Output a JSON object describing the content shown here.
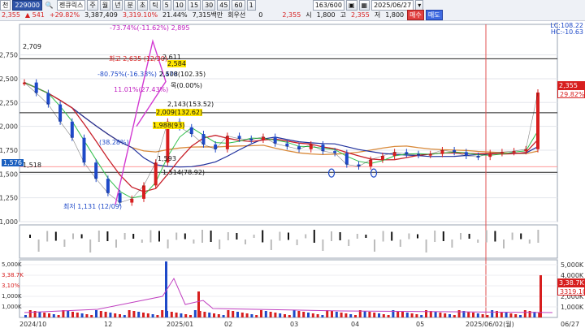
{
  "toolbar": {
    "row1": {
      "market": "천",
      "code": "229000",
      "name": "젠큐릭스",
      "periods": [
        "주",
        "월",
        "년",
        "분",
        "초",
        "틱"
      ],
      "intervals": [
        "5",
        "10",
        "15",
        "30",
        "45",
        "60",
        "1"
      ],
      "count": "163/600",
      "date": "2025/06/27"
    },
    "row2": {
      "price": "2,355",
      "change": "▲ 541",
      "change_pct": "+29.82%",
      "volume": "3,387,409",
      "amount": "3,319.10%",
      "turnover": "21.44%",
      "value": "7,315백만",
      "priority_label": "회우선",
      "priority_value": "0",
      "cur_price": "2,355",
      "open_label": "시",
      "open": "1,800",
      "high_label": "고",
      "high": "2,355",
      "low_label": "저",
      "low": "1,800",
      "buy_label": "매수",
      "sell_label": "매도"
    }
  },
  "indicator_legend": {
    "lc": "LC:108.22",
    "hc": "HC:-10.63"
  },
  "right_tags": {
    "price": "2,355",
    "pct": "29.82%",
    "low_line": "1,576",
    "vol_tag": "3,38.7K",
    "vol_pct": "3319.10%"
  },
  "chart_data": {
    "type": "line",
    "title": "",
    "xlabel": "",
    "ylabel": "",
    "y_ticks": [
      "2,750",
      "2,500",
      "2,250",
      "2,000",
      "1,750",
      "1,500",
      "1,250",
      "1,000"
    ],
    "ylim": [
      1000,
      2900
    ],
    "x_labels": [
      "2024/10",
      "12",
      "2025/01",
      "02",
      "03",
      "04",
      "05",
      "2025/06/02(월)",
      "06/27"
    ],
    "left_labels": [
      "2,709",
      "1,518",
      "1,576"
    ],
    "annotations": [
      "-73.74%(-11.62%) 2,895",
      "최고 2,635 (12/30)",
      "2,611",
      "2,584",
      "-80.75%(-16.33%) 2,470",
      "2,508(102.35)",
      "11.01%(27.43%)",
      "목(0.00%)",
      "2,143(153.52)",
      "2,009(132.62)",
      "1,988(93)",
      "(38.28%)",
      "1,593",
      "1,514(78.92)",
      "최저 1,131 (12/09)"
    ],
    "volume_ticks": [
      "5,000K",
      "4,000K",
      "3,000K",
      "2,000K",
      "1,000K"
    ],
    "volume_left_tags": [
      "5,000K",
      "3,38.7K",
      "3,10%",
      "1,000K",
      "1,000K"
    ],
    "series": [
      {
        "name": "",
        "values": [
          2460,
          2350,
          2230,
          2050,
          1880,
          1620,
          1450,
          1300,
          1200,
          1240,
          1380,
          1620,
          2050,
          1990,
          1920,
          1810,
          1760,
          1900,
          1870,
          1860,
          1890,
          1820,
          1790,
          1760,
          1810,
          1740,
          1720,
          1600,
          1580,
          1650,
          1690,
          1730,
          1710,
          1700,
          1710,
          1750,
          1730,
          1690,
          1680,
          1720,
          1730,
          1740,
          1760,
          2355
        ]
      }
    ]
  }
}
